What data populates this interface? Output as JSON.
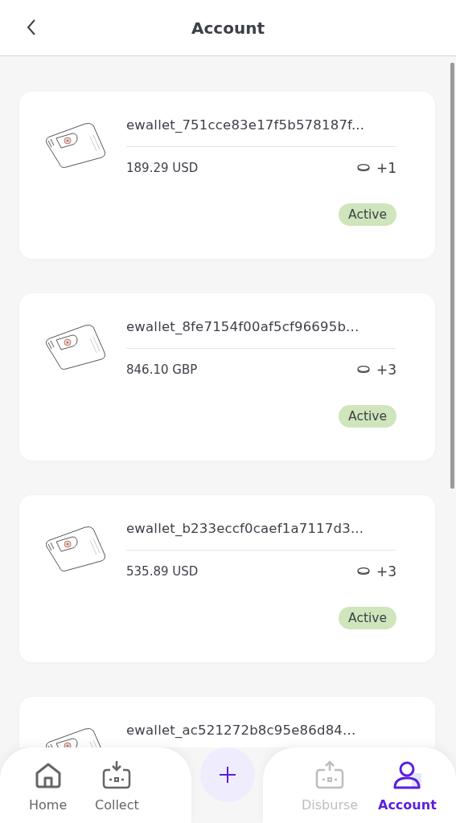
{
  "header": {
    "title": "Account"
  },
  "wallets": [
    {
      "name": "ewallet_751cce83e17f5b578187f...",
      "amount": "189.29 USD",
      "coins": "+1",
      "status": "Active"
    },
    {
      "name": "ewallet_8fe7154f00af5cf96695b...",
      "amount": "846.10 GBP",
      "coins": "+3",
      "status": "Active"
    },
    {
      "name": "ewallet_b233eccf0caef1a7117d3...",
      "amount": "535.89 USD",
      "coins": "+3",
      "status": "Active"
    },
    {
      "name": "ewallet_ac521272b8c95e86d84..."
    }
  ],
  "nav": {
    "items": [
      {
        "label": "Home",
        "selected": false,
        "disabled": false
      },
      {
        "label": "Collect",
        "selected": false,
        "disabled": false
      },
      {
        "label": "Disburse",
        "selected": false,
        "disabled": true
      },
      {
        "label": "Account",
        "selected": true,
        "disabled": false
      }
    ]
  }
}
